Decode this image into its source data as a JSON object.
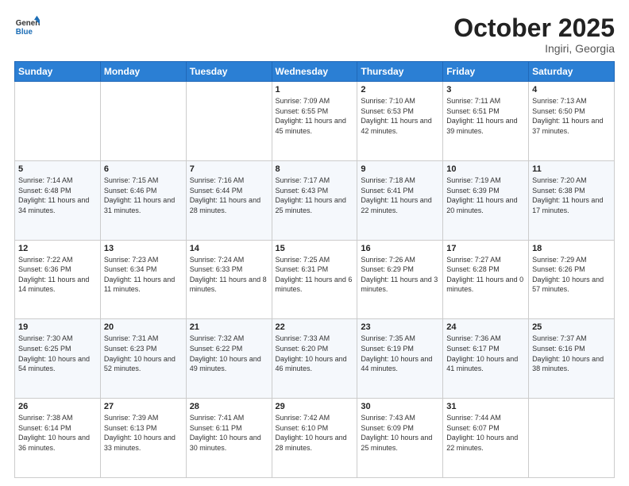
{
  "header": {
    "logo_general": "General",
    "logo_blue": "Blue",
    "month": "October 2025",
    "location": "Ingiri, Georgia"
  },
  "days_of_week": [
    "Sunday",
    "Monday",
    "Tuesday",
    "Wednesday",
    "Thursday",
    "Friday",
    "Saturday"
  ],
  "weeks": [
    [
      {
        "day": "",
        "sunrise": "",
        "sunset": "",
        "daylight": ""
      },
      {
        "day": "",
        "sunrise": "",
        "sunset": "",
        "daylight": ""
      },
      {
        "day": "",
        "sunrise": "",
        "sunset": "",
        "daylight": ""
      },
      {
        "day": "1",
        "sunrise": "Sunrise: 7:09 AM",
        "sunset": "Sunset: 6:55 PM",
        "daylight": "Daylight: 11 hours and 45 minutes."
      },
      {
        "day": "2",
        "sunrise": "Sunrise: 7:10 AM",
        "sunset": "Sunset: 6:53 PM",
        "daylight": "Daylight: 11 hours and 42 minutes."
      },
      {
        "day": "3",
        "sunrise": "Sunrise: 7:11 AM",
        "sunset": "Sunset: 6:51 PM",
        "daylight": "Daylight: 11 hours and 39 minutes."
      },
      {
        "day": "4",
        "sunrise": "Sunrise: 7:13 AM",
        "sunset": "Sunset: 6:50 PM",
        "daylight": "Daylight: 11 hours and 37 minutes."
      }
    ],
    [
      {
        "day": "5",
        "sunrise": "Sunrise: 7:14 AM",
        "sunset": "Sunset: 6:48 PM",
        "daylight": "Daylight: 11 hours and 34 minutes."
      },
      {
        "day": "6",
        "sunrise": "Sunrise: 7:15 AM",
        "sunset": "Sunset: 6:46 PM",
        "daylight": "Daylight: 11 hours and 31 minutes."
      },
      {
        "day": "7",
        "sunrise": "Sunrise: 7:16 AM",
        "sunset": "Sunset: 6:44 PM",
        "daylight": "Daylight: 11 hours and 28 minutes."
      },
      {
        "day": "8",
        "sunrise": "Sunrise: 7:17 AM",
        "sunset": "Sunset: 6:43 PM",
        "daylight": "Daylight: 11 hours and 25 minutes."
      },
      {
        "day": "9",
        "sunrise": "Sunrise: 7:18 AM",
        "sunset": "Sunset: 6:41 PM",
        "daylight": "Daylight: 11 hours and 22 minutes."
      },
      {
        "day": "10",
        "sunrise": "Sunrise: 7:19 AM",
        "sunset": "Sunset: 6:39 PM",
        "daylight": "Daylight: 11 hours and 20 minutes."
      },
      {
        "day": "11",
        "sunrise": "Sunrise: 7:20 AM",
        "sunset": "Sunset: 6:38 PM",
        "daylight": "Daylight: 11 hours and 17 minutes."
      }
    ],
    [
      {
        "day": "12",
        "sunrise": "Sunrise: 7:22 AM",
        "sunset": "Sunset: 6:36 PM",
        "daylight": "Daylight: 11 hours and 14 minutes."
      },
      {
        "day": "13",
        "sunrise": "Sunrise: 7:23 AM",
        "sunset": "Sunset: 6:34 PM",
        "daylight": "Daylight: 11 hours and 11 minutes."
      },
      {
        "day": "14",
        "sunrise": "Sunrise: 7:24 AM",
        "sunset": "Sunset: 6:33 PM",
        "daylight": "Daylight: 11 hours and 8 minutes."
      },
      {
        "day": "15",
        "sunrise": "Sunrise: 7:25 AM",
        "sunset": "Sunset: 6:31 PM",
        "daylight": "Daylight: 11 hours and 6 minutes."
      },
      {
        "day": "16",
        "sunrise": "Sunrise: 7:26 AM",
        "sunset": "Sunset: 6:29 PM",
        "daylight": "Daylight: 11 hours and 3 minutes."
      },
      {
        "day": "17",
        "sunrise": "Sunrise: 7:27 AM",
        "sunset": "Sunset: 6:28 PM",
        "daylight": "Daylight: 11 hours and 0 minutes."
      },
      {
        "day": "18",
        "sunrise": "Sunrise: 7:29 AM",
        "sunset": "Sunset: 6:26 PM",
        "daylight": "Daylight: 10 hours and 57 minutes."
      }
    ],
    [
      {
        "day": "19",
        "sunrise": "Sunrise: 7:30 AM",
        "sunset": "Sunset: 6:25 PM",
        "daylight": "Daylight: 10 hours and 54 minutes."
      },
      {
        "day": "20",
        "sunrise": "Sunrise: 7:31 AM",
        "sunset": "Sunset: 6:23 PM",
        "daylight": "Daylight: 10 hours and 52 minutes."
      },
      {
        "day": "21",
        "sunrise": "Sunrise: 7:32 AM",
        "sunset": "Sunset: 6:22 PM",
        "daylight": "Daylight: 10 hours and 49 minutes."
      },
      {
        "day": "22",
        "sunrise": "Sunrise: 7:33 AM",
        "sunset": "Sunset: 6:20 PM",
        "daylight": "Daylight: 10 hours and 46 minutes."
      },
      {
        "day": "23",
        "sunrise": "Sunrise: 7:35 AM",
        "sunset": "Sunset: 6:19 PM",
        "daylight": "Daylight: 10 hours and 44 minutes."
      },
      {
        "day": "24",
        "sunrise": "Sunrise: 7:36 AM",
        "sunset": "Sunset: 6:17 PM",
        "daylight": "Daylight: 10 hours and 41 minutes."
      },
      {
        "day": "25",
        "sunrise": "Sunrise: 7:37 AM",
        "sunset": "Sunset: 6:16 PM",
        "daylight": "Daylight: 10 hours and 38 minutes."
      }
    ],
    [
      {
        "day": "26",
        "sunrise": "Sunrise: 7:38 AM",
        "sunset": "Sunset: 6:14 PM",
        "daylight": "Daylight: 10 hours and 36 minutes."
      },
      {
        "day": "27",
        "sunrise": "Sunrise: 7:39 AM",
        "sunset": "Sunset: 6:13 PM",
        "daylight": "Daylight: 10 hours and 33 minutes."
      },
      {
        "day": "28",
        "sunrise": "Sunrise: 7:41 AM",
        "sunset": "Sunset: 6:11 PM",
        "daylight": "Daylight: 10 hours and 30 minutes."
      },
      {
        "day": "29",
        "sunrise": "Sunrise: 7:42 AM",
        "sunset": "Sunset: 6:10 PM",
        "daylight": "Daylight: 10 hours and 28 minutes."
      },
      {
        "day": "30",
        "sunrise": "Sunrise: 7:43 AM",
        "sunset": "Sunset: 6:09 PM",
        "daylight": "Daylight: 10 hours and 25 minutes."
      },
      {
        "day": "31",
        "sunrise": "Sunrise: 7:44 AM",
        "sunset": "Sunset: 6:07 PM",
        "daylight": "Daylight: 10 hours and 22 minutes."
      },
      {
        "day": "",
        "sunrise": "",
        "sunset": "",
        "daylight": ""
      }
    ]
  ]
}
